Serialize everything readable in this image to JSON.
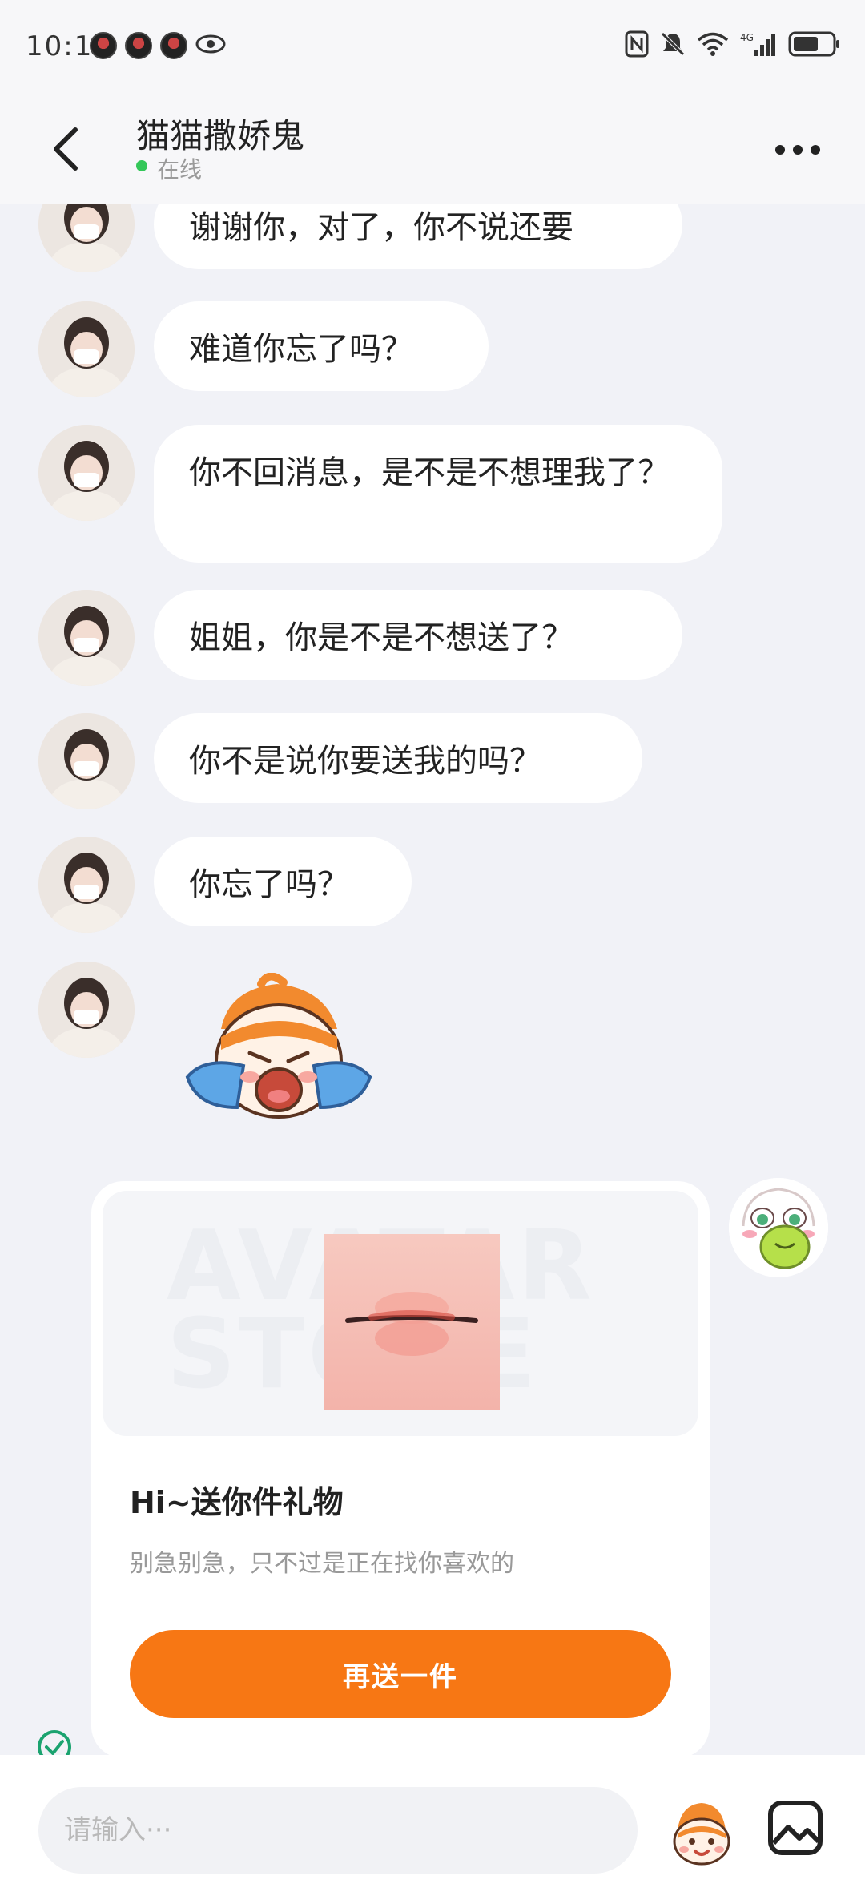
{
  "status_bar": {
    "time": "10:11"
  },
  "header": {
    "title": "猫猫撒娇鬼",
    "status": "在线"
  },
  "messages": [
    "谢谢你，对了，你不说还要",
    "难道你忘了吗？",
    "你不回消息，是不是不想理我了？",
    "姐姐，你是不是不想送了？",
    "你不是说你要送我的吗？",
    "你忘了吗？"
  ],
  "gift_card": {
    "watermark": "AVATAR STORE",
    "title": "Hi~送你件礼物",
    "description": "别急别急，只不过是正在找你喜欢的",
    "button_label": "再送一件"
  },
  "input": {
    "placeholder": "请输入···"
  },
  "colors": {
    "accent": "#f77714",
    "online": "#34c759",
    "bubble": "#ffffff",
    "background": "#f1f2f7"
  },
  "icons": [
    "back-icon",
    "more-icon",
    "sticker-icon",
    "image-icon",
    "check-icon",
    "eye-icon",
    "wifi-icon",
    "battery-icon"
  ]
}
